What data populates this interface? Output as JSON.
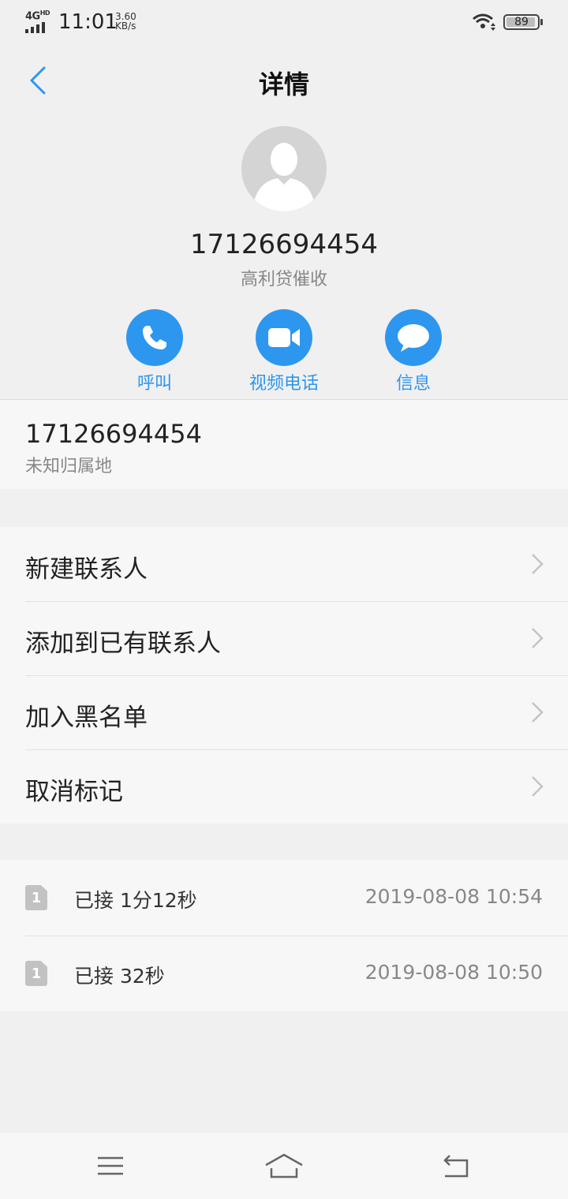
{
  "status_bar": {
    "network": "4G",
    "network_hd": "HD",
    "time": "11:01",
    "speed_value": "3.60",
    "speed_unit": "KB/s",
    "battery": "89"
  },
  "header": {
    "title": "详情",
    "back_icon": "chevron-left-icon"
  },
  "contact": {
    "avatar_icon": "person-silhouette-icon",
    "number": "17126694454",
    "tag": "高利贷催收"
  },
  "actions": [
    {
      "label": "呼叫",
      "icon": "phone-icon"
    },
    {
      "label": "视频电话",
      "icon": "video-camera-icon"
    },
    {
      "label": "信息",
      "icon": "chat-bubble-icon"
    }
  ],
  "number_info": {
    "number": "17126694454",
    "location": "未知归属地"
  },
  "menu": [
    {
      "label": "新建联系人",
      "icon": "chevron-right-icon"
    },
    {
      "label": "添加到已有联系人",
      "icon": "chevron-right-icon"
    },
    {
      "label": "加入黑名单",
      "icon": "chevron-right-icon"
    },
    {
      "label": "取消标记",
      "icon": "chevron-right-icon"
    }
  ],
  "call_log": [
    {
      "sim": "1",
      "type": "已接 1分12秒",
      "time": "2019-08-08 10:54"
    },
    {
      "sim": "1",
      "type": "已接 32秒",
      "time": "2019-08-08 10:50"
    }
  ],
  "nav_bar": {
    "menu_icon": "menu-icon",
    "home_icon": "home-icon",
    "back_icon": "back-arrow-icon"
  },
  "colors": {
    "accent": "#2d96ef",
    "background": "#f0f0f0",
    "card": "#f7f7f7"
  }
}
